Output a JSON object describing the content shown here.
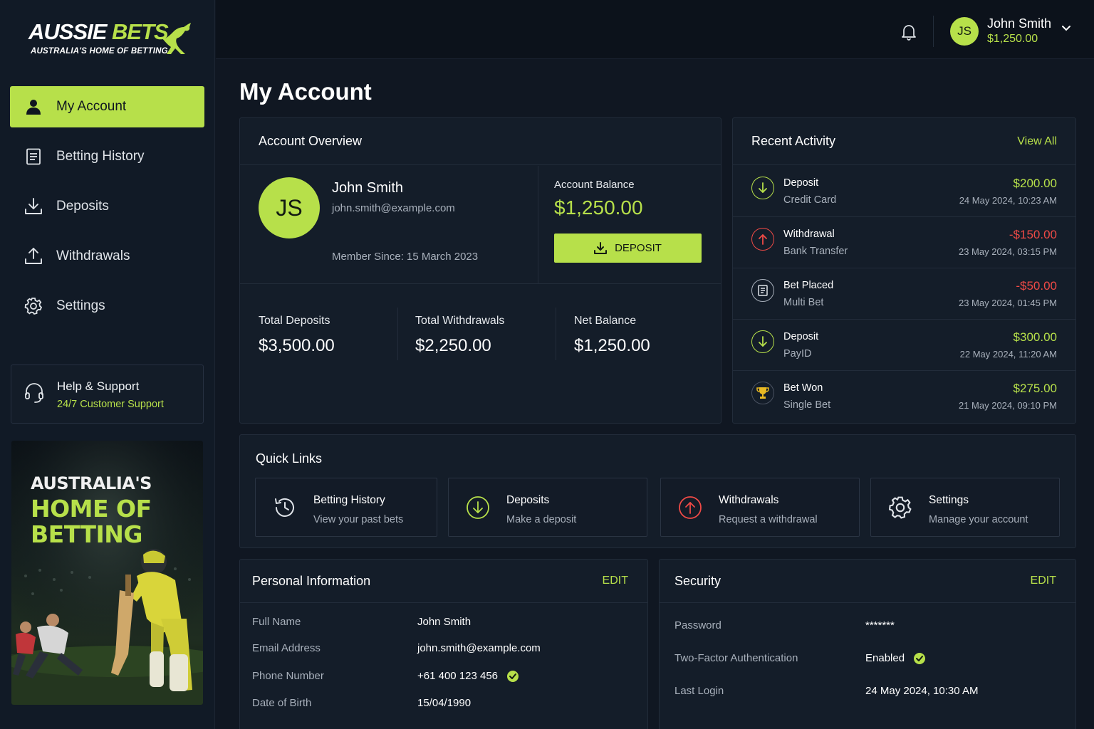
{
  "brand": {
    "name_part1": "AUSSIE",
    "name_part2": "BETS",
    "tagline": "AUSTRALIA'S HOME OF BETTING",
    "accent": "#b7e04a"
  },
  "sidebar": {
    "items": [
      {
        "label": "My Account",
        "icon": "user-icon",
        "active": true
      },
      {
        "label": "Betting History",
        "icon": "document-icon"
      },
      {
        "label": "Deposits",
        "icon": "download-icon"
      },
      {
        "label": "Withdrawals",
        "icon": "upload-icon"
      },
      {
        "label": "Settings",
        "icon": "gear-icon"
      }
    ],
    "help": {
      "title": "Help & Support",
      "subtitle": "24/7 Customer Support",
      "icon": "headset-icon"
    },
    "promo": {
      "line1": "AUSTRALIA'S",
      "line2": "HOME OF",
      "line3": "BETTING"
    }
  },
  "topbar": {
    "user_initials": "JS",
    "user_name": "John Smith",
    "user_balance": "$1,250.00"
  },
  "page_title": "My Account",
  "overview": {
    "title": "Account Overview",
    "initials": "JS",
    "name": "John Smith",
    "email": "john.smith@example.com",
    "member_since": "Member Since: 15 March 2023",
    "balance_label": "Account Balance",
    "balance_value": "$1,250.00",
    "deposit_button": "DEPOSIT",
    "stats": [
      {
        "label": "Total Deposits",
        "value": "$3,500.00"
      },
      {
        "label": "Total Withdrawals",
        "value": "$2,250.00"
      },
      {
        "label": "Net Balance",
        "value": "$1,250.00"
      }
    ]
  },
  "recent_activity": {
    "title": "Recent Activity",
    "view_all": "View All",
    "items": [
      {
        "title": "Deposit",
        "subtitle": "Credit Card",
        "amount": "$200.00",
        "date": "24 May 2024, 10:23 AM",
        "type": "deposit"
      },
      {
        "title": "Withdrawal",
        "subtitle": "Bank Transfer",
        "amount": "-$150.00",
        "date": "23 May 2024, 03:15 PM",
        "type": "withdrawal"
      },
      {
        "title": "Bet Placed",
        "subtitle": "Multi Bet",
        "amount": "-$50.00",
        "date": "23 May 2024, 01:45 PM",
        "type": "bet"
      },
      {
        "title": "Deposit",
        "subtitle": "PayID",
        "amount": "$300.00",
        "date": "22 May 2024, 11:20 AM",
        "type": "deposit"
      },
      {
        "title": "Bet Won",
        "subtitle": "Single Bet",
        "amount": "$275.00",
        "date": "21 May 2024, 09:10 PM",
        "type": "won"
      }
    ]
  },
  "quick_links": {
    "title": "Quick Links",
    "items": [
      {
        "title": "Betting History",
        "subtitle": "View your past bets",
        "icon": "history-icon"
      },
      {
        "title": "Deposits",
        "subtitle": "Make a deposit",
        "icon": "deposit-icon"
      },
      {
        "title": "Withdrawals",
        "subtitle": "Request a withdrawal",
        "icon": "withdraw-icon"
      },
      {
        "title": "Settings",
        "subtitle": "Manage your account",
        "icon": "gear-icon"
      }
    ]
  },
  "personal_info": {
    "title": "Personal Information",
    "edit": "EDIT",
    "rows": [
      {
        "label": "Full Name",
        "value": "John Smith"
      },
      {
        "label": "Email Address",
        "value": "john.smith@example.com"
      },
      {
        "label": "Phone Number",
        "value": "+61 400 123 456",
        "verified": true
      },
      {
        "label": "Date of Birth",
        "value": "15/04/1990"
      }
    ]
  },
  "security": {
    "title": "Security",
    "edit": "EDIT",
    "rows": [
      {
        "label": "Password",
        "value": "*******"
      },
      {
        "label": "Two-Factor Authentication",
        "value": "Enabled",
        "verified": true
      },
      {
        "label": "Last Login",
        "value": "24 May 2024, 10:30 AM"
      }
    ]
  }
}
